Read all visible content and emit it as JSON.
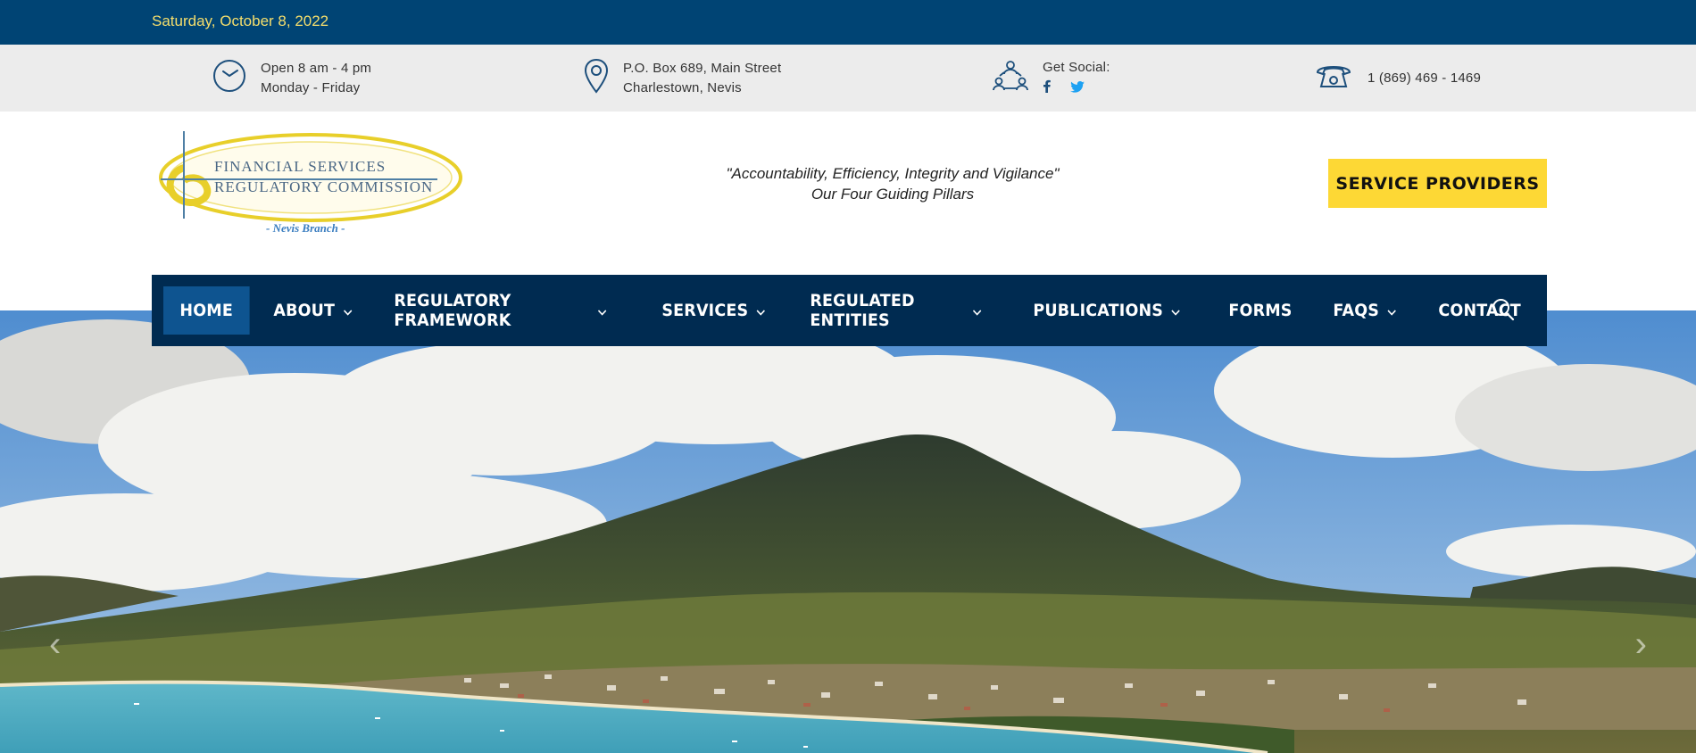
{
  "topbar": {
    "date": "Saturday, October 8, 2022"
  },
  "info": {
    "hours": {
      "line1": "Open 8 am - 4 pm",
      "line2": "Monday - Friday",
      "icon": "clock-icon"
    },
    "address": {
      "line1": "P.O. Box 689, Main Street",
      "line2": "Charlestown, Nevis",
      "icon": "map-pin-icon"
    },
    "social": {
      "label": "Get Social:",
      "icon": "people-network-icon",
      "links": [
        "facebook-icon",
        "twitter-icon"
      ]
    },
    "phone": {
      "number": "1 (869) 469 - 1469",
      "icon": "telephone-icon"
    }
  },
  "header": {
    "logo": {
      "line1": "FINANCIAL SERVICES",
      "line2": "REGULATORY COMMISSION",
      "branch": "- Nevis Branch -"
    },
    "tagline": {
      "line1": "\"Accountability, Efficiency, Integrity and Vigilance\"",
      "line2": "Our Four Guiding Pillars"
    },
    "service_providers_label": "SERVICE PROVIDERS"
  },
  "nav": {
    "items": [
      {
        "label": "HOME",
        "active": true,
        "dropdown": false
      },
      {
        "label": "ABOUT",
        "active": false,
        "dropdown": true
      },
      {
        "label": "REGULATORY FRAMEWORK",
        "active": false,
        "dropdown": true
      },
      {
        "label": "SERVICES",
        "active": false,
        "dropdown": true
      },
      {
        "label": "REGULATED ENTITIES",
        "active": false,
        "dropdown": true
      },
      {
        "label": "PUBLICATIONS",
        "active": false,
        "dropdown": true
      },
      {
        "label": "FORMS",
        "active": false,
        "dropdown": false
      },
      {
        "label": "FAQS",
        "active": false,
        "dropdown": true
      },
      {
        "label": "CONTACT",
        "active": false,
        "dropdown": false
      }
    ],
    "search_icon": "search-icon"
  },
  "hero": {
    "image": "Nevis island landscape with mountain and bay"
  },
  "colors": {
    "topbar": "#004474",
    "nav": "#002b51",
    "nav_active": "#0e5490",
    "accent_yellow": "#fdd835",
    "date_text": "#f5de6c",
    "icon_blue": "#1d4f7c"
  }
}
